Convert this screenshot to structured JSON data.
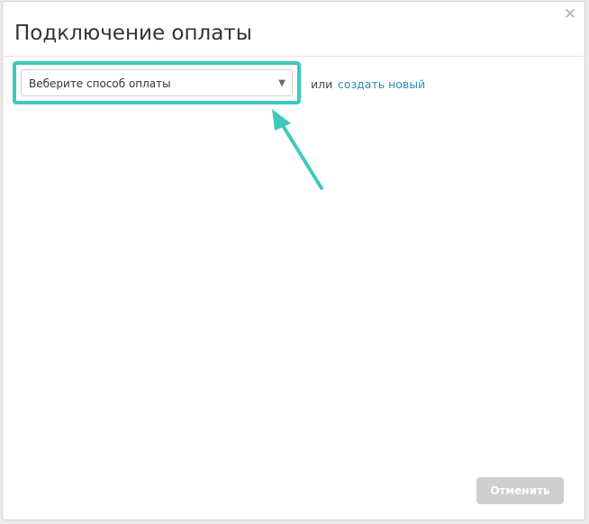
{
  "dialog": {
    "title": "Подключение оплаты",
    "close_icon": "close-icon"
  },
  "payment_select": {
    "selected_value": "Веберите способ оплаты",
    "arrow_glyph": "▼"
  },
  "alt_action": {
    "or_text": "или",
    "create_link": "создать новый"
  },
  "footer": {
    "cancel_label": "Отменить"
  },
  "colors": {
    "highlight": "#3ec9be",
    "link": "#2a8fb6",
    "cancel_bg": "#cfcfcf"
  }
}
